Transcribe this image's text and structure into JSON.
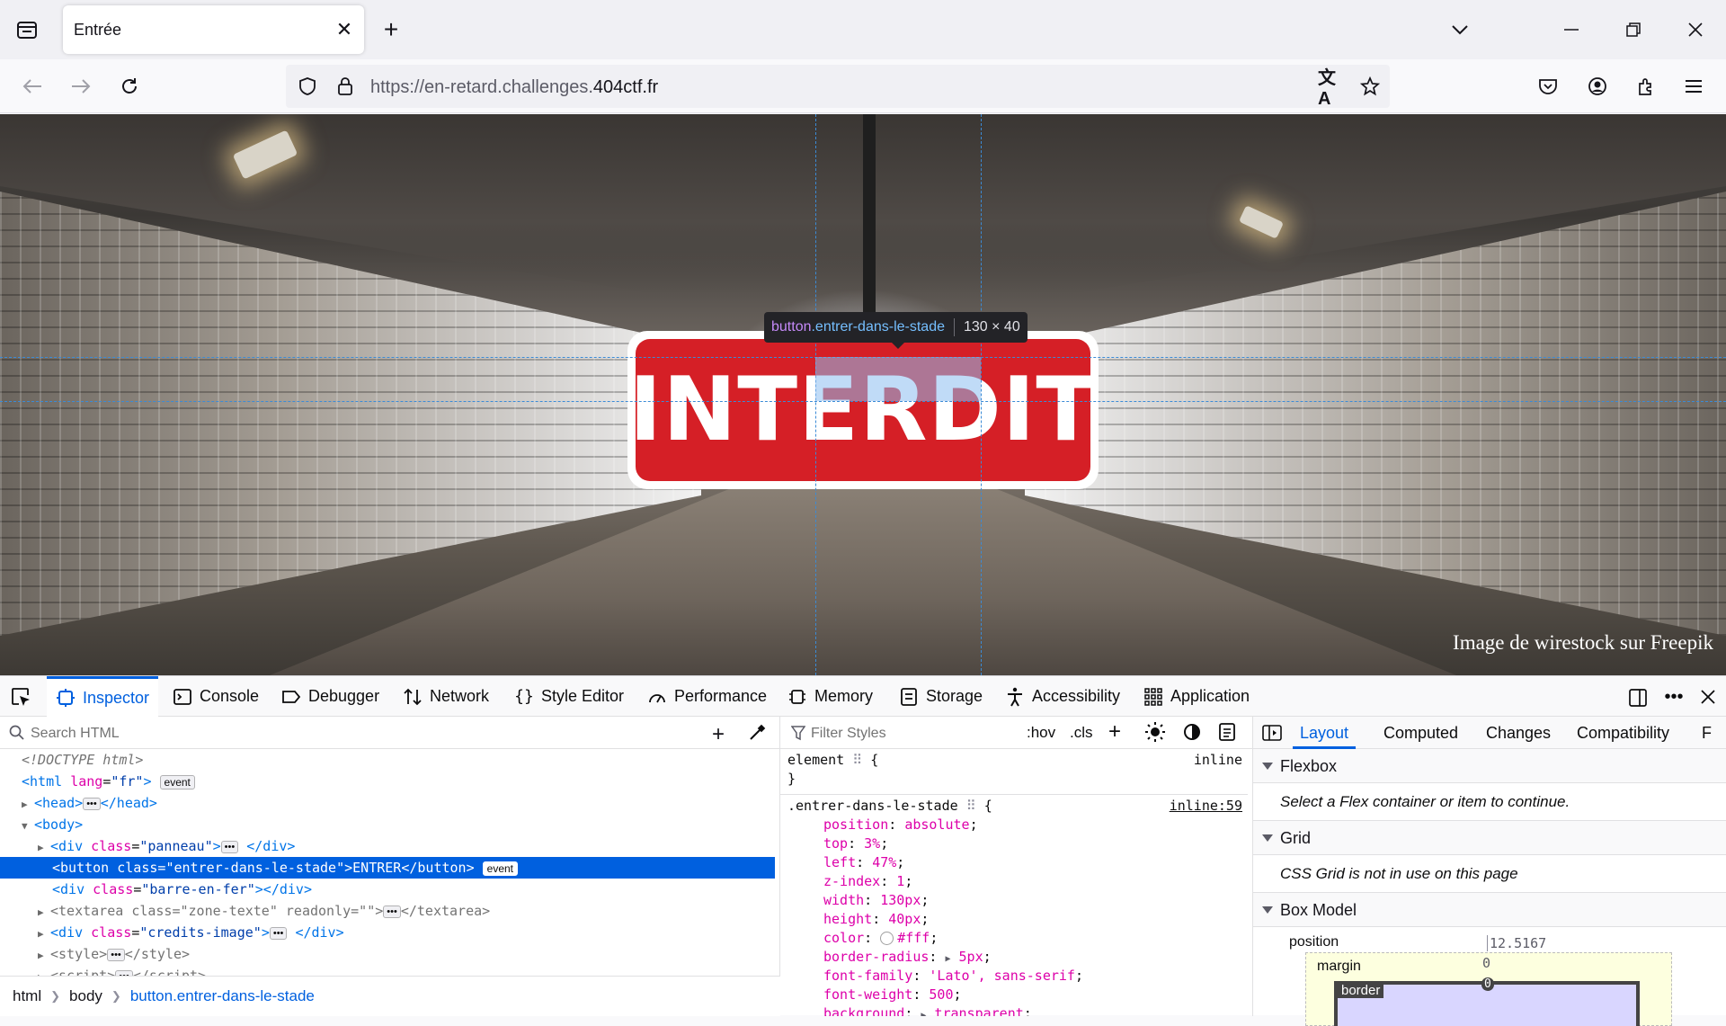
{
  "browser": {
    "tab_title": "Entrée",
    "url_prefix": "https://en-retard.challenges.",
    "url_domain": "404ctf.fr"
  },
  "page": {
    "sign_text": "INTERDIT",
    "credits": "Image de wirestock sur Freepik",
    "tooltip_tag": "button",
    "tooltip_class": ".entrer-dans-le-stade",
    "tooltip_dims": "130 × 40"
  },
  "devtools": {
    "tabs": [
      {
        "label": "Inspector",
        "icon": "inspector-icon"
      },
      {
        "label": "Console",
        "icon": "console-icon"
      },
      {
        "label": "Debugger",
        "icon": "debugger-icon"
      },
      {
        "label": "Network",
        "icon": "network-icon"
      },
      {
        "label": "Style Editor",
        "icon": "style-editor-icon"
      },
      {
        "label": "Performance",
        "icon": "performance-icon"
      },
      {
        "label": "Memory",
        "icon": "memory-icon"
      },
      {
        "label": "Storage",
        "icon": "storage-icon"
      },
      {
        "label": "Accessibility",
        "icon": "accessibility-icon"
      },
      {
        "label": "Application",
        "icon": "application-icon"
      }
    ],
    "search_placeholder": "Search HTML",
    "tree": {
      "doctype": "<!DOCTYPE html>",
      "html_lang_val": "\"fr\"",
      "event": "event",
      "panneau": "\"panneau\"",
      "button_class": "\"entrer-dans-le-stade\"",
      "button_text": "ENTRER",
      "barre": "\"barre-en-fer\"",
      "zone": "\"zone-texte\"",
      "readonly": "readonly=\"\"",
      "credits_class": "\"credits-image\""
    },
    "breadcrumbs": [
      "html",
      "body",
      "button.entrer-dans-le-stade"
    ],
    "rules": {
      "filter_placeholder": "Filter Styles",
      "hov": ":hov",
      "cls": ".cls",
      "element_selector": "element",
      "element_source": "inline",
      "selector": ".entrer-dans-le-stade",
      "source": "inline:59",
      "props": [
        {
          "name": "position",
          "value": "absolute"
        },
        {
          "name": "top",
          "value": "3%"
        },
        {
          "name": "left",
          "value": "47%"
        },
        {
          "name": "z-index",
          "value": "1"
        },
        {
          "name": "width",
          "value": "130px"
        },
        {
          "name": "height",
          "value": "40px"
        },
        {
          "name": "color",
          "value": "#fff"
        },
        {
          "name": "border-radius",
          "value": "5px"
        },
        {
          "name": "font-family",
          "value": "'Lato', sans-serif"
        },
        {
          "name": "font-weight",
          "value": "500"
        },
        {
          "name": "background",
          "value": "transparent"
        }
      ]
    },
    "layout": {
      "tabs": [
        "Layout",
        "Computed",
        "Changes",
        "Compatibility",
        "F"
      ],
      "flexbox_title": "Flexbox",
      "flexbox_msg": "Select a Flex container or item to continue.",
      "grid_title": "Grid",
      "grid_msg": "CSS Grid is not in use on this page",
      "boxmodel_title": "Box Model",
      "position_label": "position",
      "position_val": "12.5167",
      "margin_label": "margin",
      "margin_val": "0",
      "border_label": "border",
      "border_val": "0"
    }
  }
}
